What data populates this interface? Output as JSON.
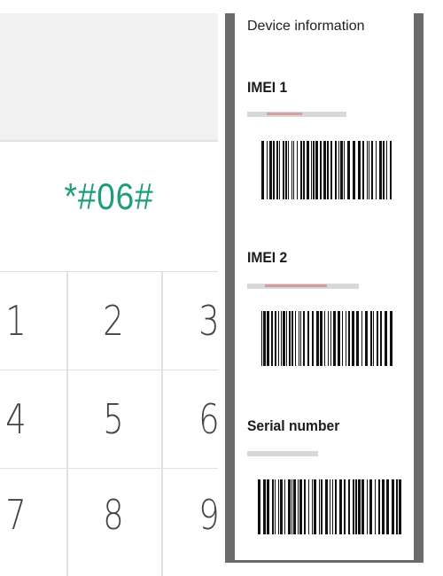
{
  "dialer": {
    "code": "*#06#",
    "keys": [
      "1",
      "2",
      "3",
      "4",
      "5",
      "6",
      "7",
      "8",
      "9"
    ]
  },
  "device_info": {
    "title": "Device information",
    "sections": [
      {
        "label": "IMEI 1"
      },
      {
        "label": "IMEI 2"
      },
      {
        "label": "Serial number"
      }
    ]
  },
  "colors": {
    "code_text": "#1e9d79",
    "frame": "#6b6b6b",
    "display_bg": "#f1f1f1"
  }
}
